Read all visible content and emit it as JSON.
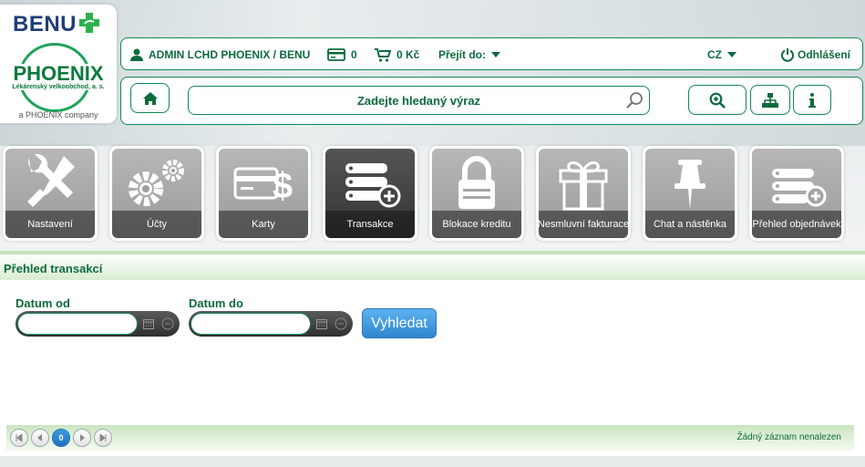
{
  "logo": {
    "benu": "BENU",
    "phoenix": "PHOENIX",
    "phoenix_sub": "Lékárenský velkoobchod, a. s.",
    "company": "a PHOENIX company"
  },
  "header": {
    "user": "ADMIN LCHD PHOENIX / BENU",
    "card_count": "0",
    "cart_amount": "0 Kč",
    "goto_label": "Přejít do:",
    "language": "CZ",
    "logout": "Odhlášení"
  },
  "search": {
    "placeholder": "Zadejte hledaný výraz"
  },
  "tiles": [
    {
      "label": "Nastavení",
      "icon": "tools-icon"
    },
    {
      "label": "Účty",
      "icon": "gears-icon"
    },
    {
      "label": "Karty",
      "icon": "card-dollar-icon"
    },
    {
      "label": "Transakce",
      "icon": "server-plus-icon",
      "active": true
    },
    {
      "label": "Blokace kreditu",
      "icon": "lock-icon"
    },
    {
      "label": "Nesmluvní fakturace",
      "icon": "gift-icon"
    },
    {
      "label": "Chat a nástěnka",
      "icon": "pushpin-icon"
    },
    {
      "label": "Přehled objednávek",
      "icon": "server-plus-icon"
    }
  ],
  "section": {
    "title": "Přehled transakcí",
    "date_from_label": "Datum od",
    "date_to_label": "Datum do",
    "date_from_value": "",
    "date_to_value": "",
    "search_button": "Vyhledat"
  },
  "pager": {
    "current_page": "0",
    "no_records": "Žádný záznam nenalezen"
  },
  "colors": {
    "brand_green": "#0d6b3d",
    "border_green": "#138a52",
    "button_blue": "#2f86cf"
  }
}
